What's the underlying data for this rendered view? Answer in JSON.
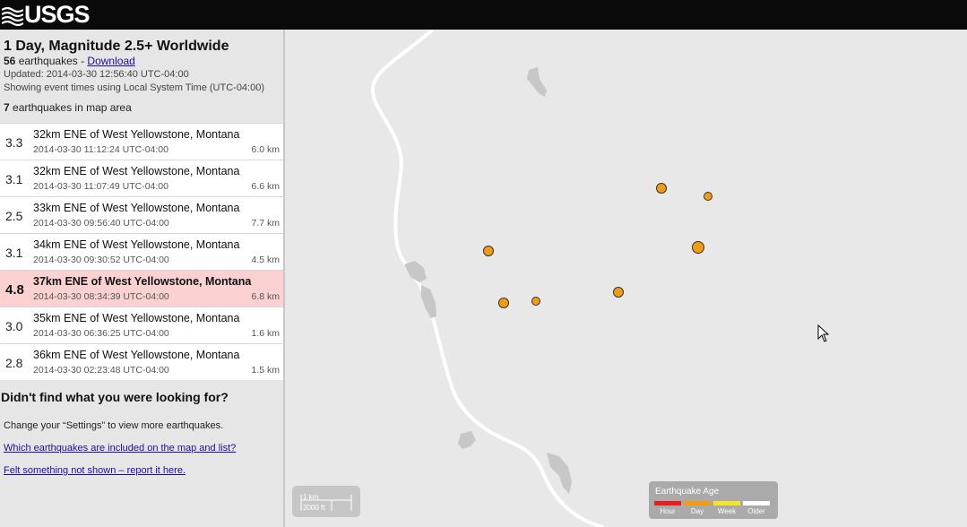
{
  "brand": {
    "name": "USGS"
  },
  "feed": {
    "title": "1 Day, Magnitude 2.5+ Worldwide",
    "count": "56",
    "count_suffix": "earthquakes - ",
    "download_label": "Download",
    "updated": "Updated: 2014-03-30 12:56:40 UTC-04:00",
    "time_note": "Showing event times using Local System Time (UTC-04:00)",
    "in_map_count": "7",
    "in_map_suffix": "earthquakes in map area"
  },
  "events": [
    {
      "mag": "3.3",
      "place": "32km ENE of West Yellowstone, Montana",
      "time": "2014-03-30 11:12:24 UTC-04:00",
      "depth": "6.0 km"
    },
    {
      "mag": "3.1",
      "place": "32km ENE of West Yellowstone, Montana",
      "time": "2014-03-30 11:07:49 UTC-04:00",
      "depth": "6.6 km"
    },
    {
      "mag": "2.5",
      "place": "33km ENE of West Yellowstone, Montana",
      "time": "2014-03-30 09:56:40 UTC-04:00",
      "depth": "7.7 km"
    },
    {
      "mag": "3.1",
      "place": "34km ENE of West Yellowstone, Montana",
      "time": "2014-03-30 09:30:52 UTC-04:00",
      "depth": "4.5 km"
    },
    {
      "mag": "4.8",
      "place": "37km ENE of West Yellowstone, Montana",
      "time": "2014-03-30 08:34:39 UTC-04:00",
      "depth": "6.8 km",
      "selected": true
    },
    {
      "mag": "3.0",
      "place": "35km ENE of West Yellowstone, Montana",
      "time": "2014-03-30 06:36:25 UTC-04:00",
      "depth": "1.6 km"
    },
    {
      "mag": "2.8",
      "place": "36km ENE of West Yellowstone, Montana",
      "time": "2014-03-30 02:23:48 UTC-04:00",
      "depth": "1.5 km"
    }
  ],
  "footer": {
    "heading": "Didn't find what you were looking for?",
    "settings_text": "Change your “Settings” to view more earthquakes.",
    "link_included": "Which earthquakes are included on the map and list?",
    "link_report": "Felt something not shown – report it here."
  },
  "map": {
    "scale_km": "1 km",
    "scale_ft": "3000 ft",
    "legend_title": "Earthquake Age",
    "legend": [
      {
        "label": "Hour",
        "color": "#e81d1d"
      },
      {
        "label": "Day",
        "color": "#f39c12"
      },
      {
        "label": "Week",
        "color": "#f5e52a"
      },
      {
        "label": "Older",
        "color": "#ffffff"
      }
    ],
    "quake_color": "#f39c12"
  }
}
